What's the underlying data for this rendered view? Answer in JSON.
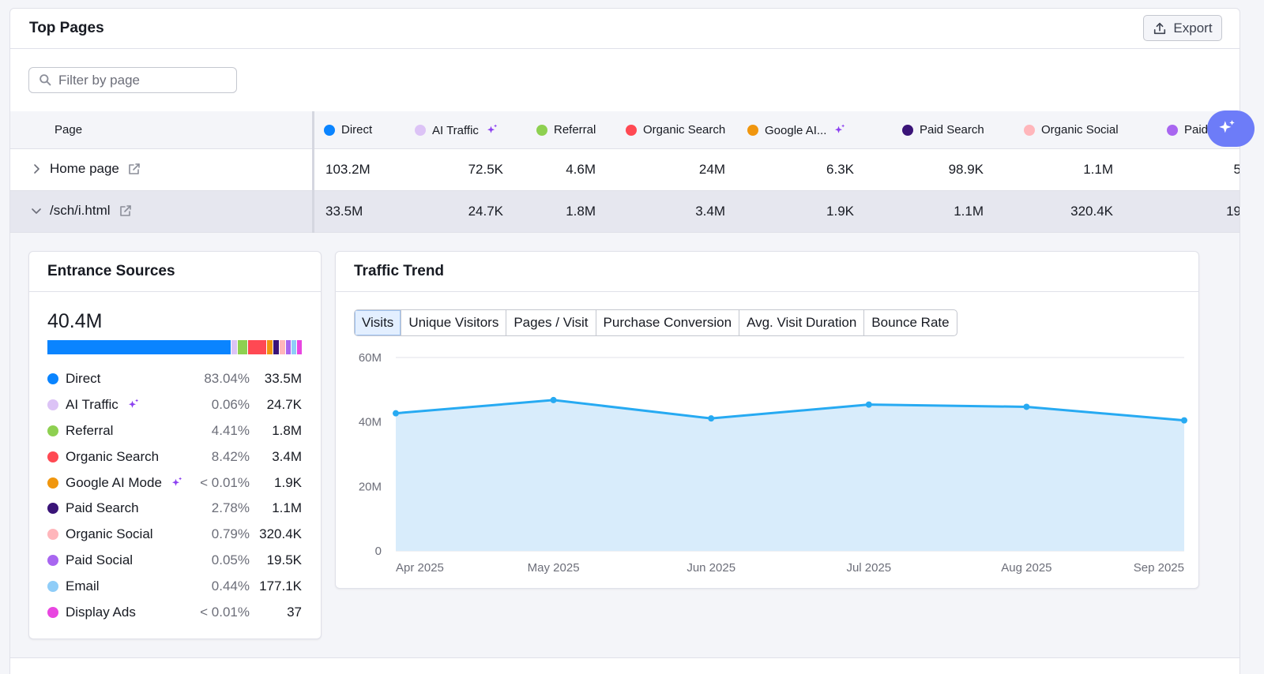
{
  "header": {
    "title": "Top Pages",
    "export_label": "Export"
  },
  "filter": {
    "placeholder": "Filter by page",
    "value": ""
  },
  "table": {
    "page_header": "Page",
    "columns": [
      {
        "label": "Direct",
        "color": "#0a84ff",
        "ai": false
      },
      {
        "label": "AI Traffic",
        "color": "#dcc3f6",
        "ai": true
      },
      {
        "label": "Referral",
        "color": "#8ed051",
        "ai": false
      },
      {
        "label": "Organic Search",
        "color": "#ff4953",
        "ai": false
      },
      {
        "label": "Google AI...",
        "color": "#f0960e",
        "ai": true
      },
      {
        "label": "Paid Search",
        "color": "#3a1478",
        "ai": false
      },
      {
        "label": "Organic Social",
        "color": "#ffb6bb",
        "ai": false
      },
      {
        "label": "Paid",
        "color": "#a866f0",
        "ai": false
      }
    ],
    "rows": [
      {
        "page": "Home page",
        "values": [
          "103.2M",
          "72.5K",
          "4.6M",
          "24M",
          "6.3K",
          "98.9K",
          "1.1M",
          "5"
        ]
      },
      {
        "page": "/sch/i.html",
        "values": [
          "33.5M",
          "24.7K",
          "1.8M",
          "3.4M",
          "1.9K",
          "1.1M",
          "320.4K",
          "19"
        ]
      }
    ]
  },
  "entrance": {
    "title": "Entrance Sources",
    "total": "40.4M",
    "sources": [
      {
        "name": "Direct",
        "pct": "83.04%",
        "value": "33.5M",
        "color": "#0a84ff",
        "ai": false,
        "share": 83.04
      },
      {
        "name": "AI Traffic",
        "pct": "0.06%",
        "value": "24.7K",
        "color": "#dcc3f6",
        "ai": true,
        "share": 0.06
      },
      {
        "name": "Referral",
        "pct": "4.41%",
        "value": "1.8M",
        "color": "#8ed051",
        "ai": false,
        "share": 4.41
      },
      {
        "name": "Organic Search",
        "pct": "8.42%",
        "value": "3.4M",
        "color": "#ff4953",
        "ai": false,
        "share": 8.42
      },
      {
        "name": "Google AI Mode",
        "pct": "< 0.01%",
        "value": "1.9K",
        "color": "#f0960e",
        "ai": true,
        "share": 0.01
      },
      {
        "name": "Paid Search",
        "pct": "2.78%",
        "value": "1.1M",
        "color": "#3a1478",
        "ai": false,
        "share": 2.78
      },
      {
        "name": "Organic Social",
        "pct": "0.79%",
        "value": "320.4K",
        "color": "#ffb6bb",
        "ai": false,
        "share": 0.79
      },
      {
        "name": "Paid Social",
        "pct": "0.05%",
        "value": "19.5K",
        "color": "#a866f0",
        "ai": false,
        "share": 0.05
      },
      {
        "name": "Email",
        "pct": "0.44%",
        "value": "177.1K",
        "color": "#8fcdf8",
        "ai": false,
        "share": 0.44
      },
      {
        "name": "Display Ads",
        "pct": "< 0.01%",
        "value": "37",
        "color": "#e846e0",
        "ai": false,
        "share": 0.01
      }
    ]
  },
  "trend": {
    "title": "Traffic Trend",
    "tabs": [
      "Visits",
      "Unique Visitors",
      "Pages / Visit",
      "Purchase Conversion",
      "Avg. Visit Duration",
      "Bounce Rate"
    ],
    "active_tab": "Visits"
  },
  "chart_data": {
    "type": "area",
    "x": [
      "Apr 2025",
      "May 2025",
      "Jun 2025",
      "Jul 2025",
      "Aug 2025",
      "Sep 2025"
    ],
    "series": [
      {
        "values": [
          42.7,
          46.8,
          41.1,
          45.4,
          44.7,
          40.5
        ],
        "color": "#27aaf2"
      }
    ],
    "yticks": [
      "0",
      "20M",
      "40M",
      "60M"
    ],
    "ylim": [
      0,
      60
    ],
    "grid": true
  }
}
